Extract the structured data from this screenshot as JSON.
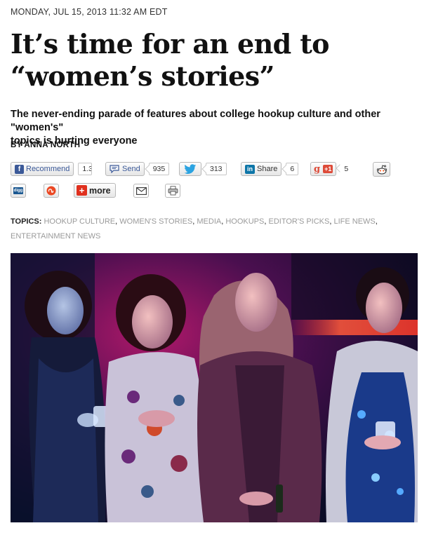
{
  "article": {
    "dateline": "MONDAY, JUL 15, 2013 11:32 AM EDT",
    "headline_line1": "It’s time for an end to",
    "headline_line2": "“women’s stories”",
    "dek_line1": "The never-ending parade of features about college hookup culture and other \"women's\"",
    "dek_line2": "topics is hurting everyone",
    "byline": "BY ANNA NORTH"
  },
  "share": {
    "facebook": {
      "label": "Recommend",
      "count": "1.3",
      "icon": "facebook-icon",
      "color": "#3b5998"
    },
    "send": {
      "label": "Send",
      "count": "935",
      "icon": "speech-bubble-icon"
    },
    "twitter": {
      "count": "313",
      "icon": "twitter-bird-icon",
      "color": "#2ba3e1"
    },
    "linkedin": {
      "label": "Share",
      "count": "6",
      "icon": "linkedin-icon",
      "icon_text": "in",
      "color": "#0e76a8"
    },
    "gplus": {
      "label": "+1",
      "count": "5",
      "icon": "google-plus-icon",
      "icon_text": "g",
      "color": "#dd4b39"
    },
    "reddit": {
      "icon": "reddit-alien-icon"
    },
    "digg": {
      "icon": "digg-icon",
      "icon_text": "digg"
    },
    "stumbleupon": {
      "icon": "stumbleupon-icon",
      "color": "#eb4823"
    },
    "more": {
      "label": "more",
      "icon": "plus-icon",
      "color": "#e0301e"
    },
    "email": {
      "icon": "envelope-icon"
    },
    "print": {
      "icon": "printer-icon"
    }
  },
  "topics": {
    "label": "TOPICS:",
    "items": [
      "HOOKUP CULTURE",
      "WOMEN'S STORIES",
      "MEDIA",
      "HOOKUPS",
      "EDITOR'S PICKS",
      "LIFE NEWS",
      "ENTERTAINMENT NEWS"
    ]
  },
  "photo": {
    "subject": "four-women-at-party-photo"
  }
}
